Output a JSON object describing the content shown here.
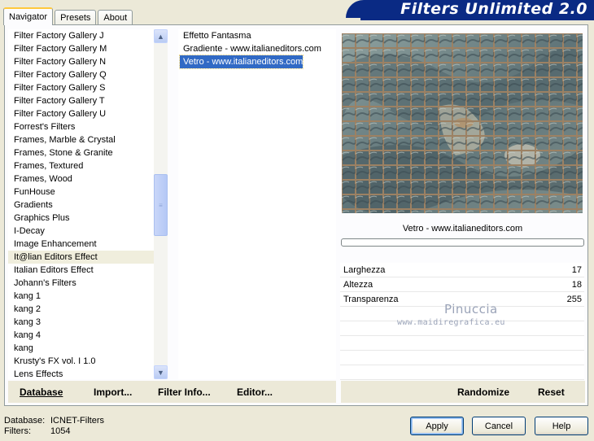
{
  "tabs": [
    {
      "label": "Navigator"
    },
    {
      "label": "Presets"
    },
    {
      "label": "About"
    }
  ],
  "banner": {
    "title": "Filters Unlimited 2.0"
  },
  "categories": [
    "Filter Factory Gallery J",
    "Filter Factory Gallery M",
    "Filter Factory Gallery N",
    "Filter Factory Gallery Q",
    "Filter Factory Gallery S",
    "Filter Factory Gallery T",
    "Filter Factory Gallery U",
    "Forrest's Filters",
    "Frames, Marble & Crystal",
    "Frames, Stone & Granite",
    "Frames, Textured",
    "Frames, Wood",
    "FunHouse",
    "Gradients",
    "Graphics Plus",
    "I-Decay",
    "Image Enhancement",
    "It@lian Editors Effect",
    "Italian Editors Effect",
    "Johann's Filters",
    "kang 1",
    "kang 2",
    "kang 3",
    "kang 4",
    "kang",
    "Krusty's FX vol. I 1.0",
    "Lens Effects"
  ],
  "selected_category": "It@lian Editors Effect",
  "filters": [
    "Effetto Fantasma",
    "Gradiente - www.italianeditors.com",
    "Vetro - www.italianeditors.com"
  ],
  "selected_filter": "Vetro - www.italianeditors.com",
  "preview": {
    "filter_name": "Vetro - www.italianeditors.com"
  },
  "params": [
    {
      "name": "Larghezza",
      "value": "17"
    },
    {
      "name": "Altezza",
      "value": "18"
    },
    {
      "name": "Transparenza",
      "value": "255"
    }
  ],
  "watermark": {
    "line1": "Pinuccia",
    "line2": "www.maidiregrafica.eu"
  },
  "left_buttons": {
    "database": "Database",
    "import": "Import...",
    "filter_info": "Filter Info...",
    "editor": "Editor..."
  },
  "right_buttons": {
    "randomize": "Randomize",
    "reset": "Reset"
  },
  "footer": {
    "database_label": "Database:",
    "database_value": "ICNET-Filters",
    "filters_label": "Filters:",
    "filters_value": "1054"
  },
  "dialog_buttons": {
    "apply": "Apply",
    "cancel": "Cancel",
    "help": "Help"
  },
  "colors": {
    "banner": "#0a2a84",
    "selection": "#316ac5",
    "dialog_bg": "#ece9d8"
  }
}
